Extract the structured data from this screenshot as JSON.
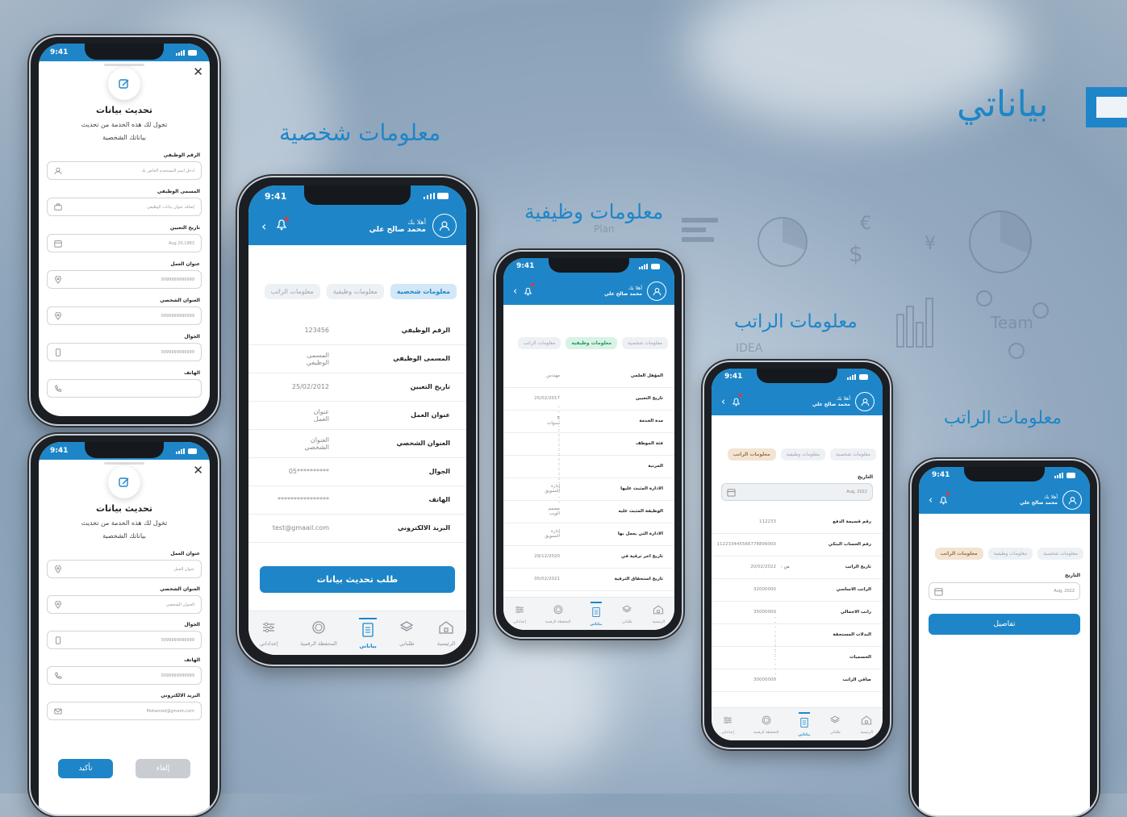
{
  "page_title": "بياناتي",
  "sections": {
    "personal": "معلومات شخصية",
    "job": "معلومات وظيفية",
    "salary1": "معلومات الراتب",
    "salary2": "معلومات الراتب"
  },
  "colors": {
    "accent": "#1e86c8",
    "background": "#9fb2c4"
  },
  "status": {
    "time": "9:41"
  },
  "header": {
    "greeting": "أهلا بك",
    "user": "محمد صالح علي"
  },
  "tabs": {
    "personal": "معلومات شخصية",
    "job": "معلومات وظيفية",
    "salary": "معلومات الراتب"
  },
  "nav": {
    "home": "الرئيسية",
    "requests": "طلباتي",
    "mydata": "بياناتي",
    "wallet": "المحفظة الرقمية",
    "settings": "إعداداتي"
  },
  "personal": {
    "rows": [
      {
        "label": "الرقم الوظيفي",
        "value": "123456"
      },
      {
        "label": "المسمى الوظيفي",
        "value": "المسمى الوظيفي"
      },
      {
        "label": "تاريخ التعيين",
        "value": "25/02/2012"
      },
      {
        "label": "عنوان العمل",
        "value": "عنوان العمل"
      },
      {
        "label": "العنوان الشخصي",
        "value": "العنوان الشخصي"
      },
      {
        "label": "الجوال",
        "value": "**********05"
      },
      {
        "label": "الهاتف",
        "value": "****************"
      },
      {
        "label": "البريد الالكتروني",
        "value": "test@gmaail.com"
      }
    ],
    "button": "طلب تحديث بيانات"
  },
  "job": {
    "rows": [
      {
        "label": "المؤهل العلمي",
        "value": "مهندس"
      },
      {
        "label": "تاريخ التعيين",
        "value": "25/02/2017"
      },
      {
        "label": "مدة الخدمة",
        "value": "5 سنوات"
      },
      {
        "label": "فئة الموظف",
        "value": "----------------"
      },
      {
        "label": "المرتبة",
        "value": "----------------"
      },
      {
        "label": "الادارة المثبت عليها",
        "value": "إدارة التسويق"
      },
      {
        "label": "الوظيفة المثبت عليه",
        "value": "مصمم الويب"
      },
      {
        "label": "الادارة التي يعمل بها",
        "value": "إدارة التسويق"
      },
      {
        "label": "تاريخ اخر ترقية في",
        "value": "29/12/2020"
      },
      {
        "label": "تاريخ استحقاق الترقية",
        "value": "05/02/2021"
      }
    ]
  },
  "salary": {
    "date_label": "التاريخ",
    "date_value": "Aug, 2022",
    "rows": [
      {
        "label": "رقم قسيمة الدفع",
        "value": "112233"
      },
      {
        "label": "رقم الحساب البنكي",
        "value": "112233445566778899000"
      },
      {
        "label": "تاريخ الراتب",
        "from": "من :",
        "value": "20/02/2022"
      },
      {
        "label": "الراتب الاساسي",
        "value": "32000000"
      },
      {
        "label": "راتب الاجمالي",
        "value": "35000000"
      },
      {
        "label": "البدلات المستحقة",
        "value": "----------"
      },
      {
        "label": "الحسميات",
        "value": "----------"
      },
      {
        "label": "صافي الراتب",
        "value": "30000000"
      }
    ],
    "details_button": "تفاصيل"
  },
  "update": {
    "title": "تحديث بيانات",
    "desc1": "تخول لك هذه الخدمة من تحديث",
    "desc2": "بياناتك الشخصية",
    "form1": [
      {
        "label": "الرقم الوظيفي",
        "placeholder": "ادخل اسم المستخدم الخاص بك",
        "icon": "user-icon"
      },
      {
        "label": "المسمى الوظيفي",
        "placeholder": "إضافة عنوان بيانات الوظيفي",
        "icon": "briefcase-icon"
      },
      {
        "label": "تاريخ التعيين",
        "placeholder": "Aug 20,1983",
        "icon": "calendar-icon"
      },
      {
        "label": "عنوان العمل",
        "placeholder": "0099999999999",
        "icon": "location-icon"
      },
      {
        "label": "العنوان الشخصي",
        "placeholder": "0099999999999",
        "icon": "location-icon"
      },
      {
        "label": "الجوال",
        "placeholder": "0099999999999",
        "icon": "mobile-icon"
      },
      {
        "label": "الهاتف",
        "placeholder": "",
        "icon": "phone-icon"
      }
    ],
    "form2": [
      {
        "label": "عنوان العمل",
        "placeholder": "عنوان العمل",
        "icon": "location-icon"
      },
      {
        "label": "العنوان الشخصي",
        "placeholder": "العنوان الشخصي",
        "icon": "location-icon"
      },
      {
        "label": "الجوال",
        "placeholder": "0099999999999",
        "icon": "mobile-icon"
      },
      {
        "label": "الهاتف",
        "placeholder": "0099999999999",
        "icon": "phone-icon"
      },
      {
        "label": "البريد الالكتروني",
        "placeholder": "Mohamed@gmaim.com",
        "icon": "mail-icon"
      }
    ],
    "confirm": "تأكيد",
    "cancel": "إلغاء"
  },
  "sketch": {
    "w1": "Team",
    "w2": "IDEA",
    "w3": "Plan",
    "w4": "$",
    "w5": "€",
    "w6": "¥"
  }
}
